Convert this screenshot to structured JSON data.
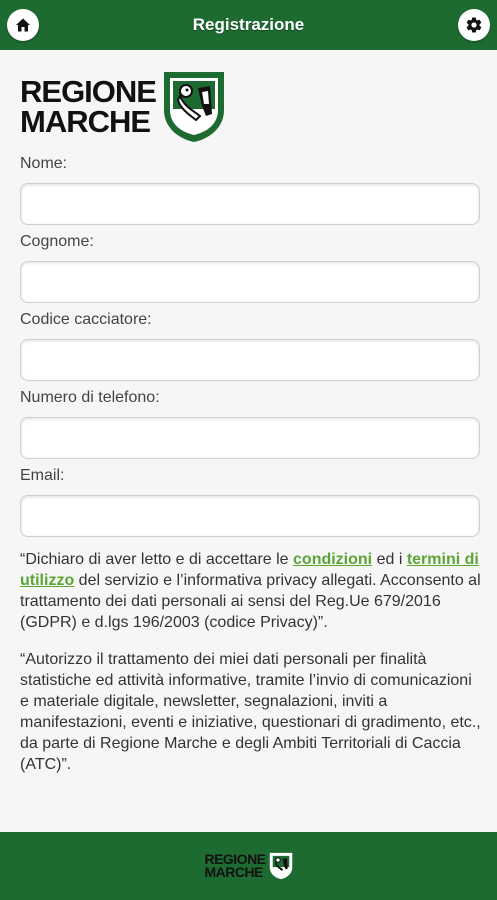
{
  "header": {
    "title": "Registrazione",
    "home_icon": "home-icon",
    "settings_icon": "gear-icon"
  },
  "logo": {
    "line1": "REGIONE",
    "line2": "MARCHE"
  },
  "form": {
    "fields": [
      {
        "label": "Nome:",
        "value": ""
      },
      {
        "label": "Cognome:",
        "value": ""
      },
      {
        "label": "Codice cacciatore:",
        "value": ""
      },
      {
        "label": "Numero di telefono:",
        "value": ""
      },
      {
        "label": "Email:",
        "value": ""
      }
    ]
  },
  "consent": {
    "p1_before": "“Dichiaro di aver letto e di accettare le ",
    "p1_link1": "condizioni",
    "p1_mid": " ed i ",
    "p1_link2": "termini di utilizzo",
    "p1_after": " del servizio e l’informativa privacy allegati. Acconsento al trattamento dei dati personali ai sensi del Reg.Ue 679/2016 (GDPR) e d.lgs 196/2003 (codice Privacy)”.",
    "p2": "“Autorizzo il trattamento dei miei dati personali per finalità statistiche ed attività informative, tramite l’invio di comunicazioni e materiale digitale, newsletter, segnalazioni, inviti a manifestazioni, eventi e iniziative, questionari di gradimento, etc., da parte di Regione Marche e degli Ambiti Territoriali di Caccia (ATC)”."
  },
  "footer": {
    "line1": "REGIONE",
    "line2": "MARCHE"
  },
  "colors": {
    "primary": "#1e6b32",
    "link": "#5ca535"
  }
}
